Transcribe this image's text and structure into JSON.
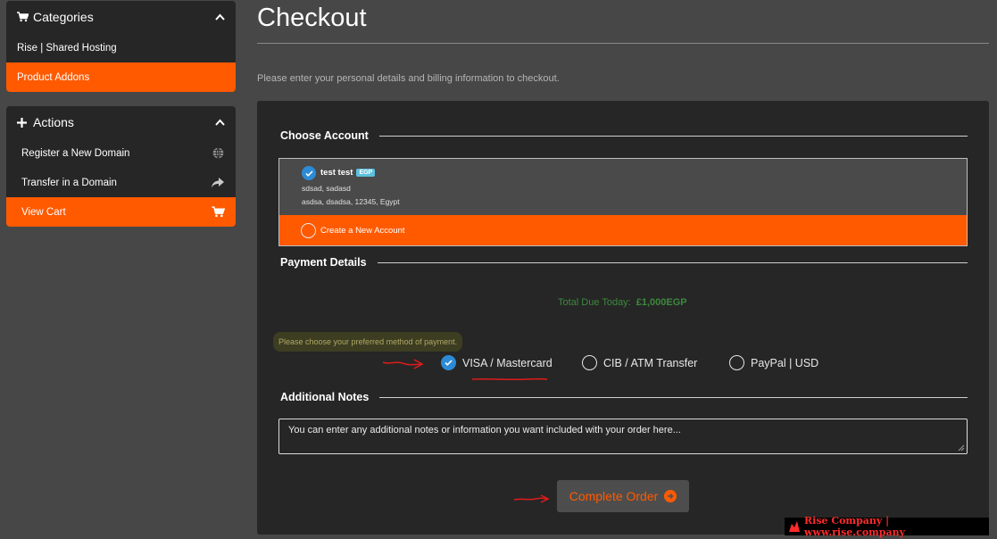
{
  "sidebar": {
    "categories": {
      "title": "Categories",
      "items": [
        {
          "label": "Rise | Shared Hosting",
          "active": false
        },
        {
          "label": "Product Addons",
          "active": true
        }
      ]
    },
    "actions": {
      "title": "Actions",
      "items": [
        {
          "label": "Register a New Domain",
          "icon": "globe-icon"
        },
        {
          "label": "Transfer in a Domain",
          "icon": "share-arrow-icon"
        },
        {
          "label": "View Cart",
          "icon": "cart-icon",
          "active": true
        }
      ]
    }
  },
  "page": {
    "title": "Checkout",
    "intro": "Please enter your personal details and billing information to checkout."
  },
  "account": {
    "section_title": "Choose Account",
    "selected": {
      "name": "test test",
      "currency_badge": "EGP",
      "line1": "sdsad, sadasd",
      "line2": "asdsa, dsadsa, 12345, Egypt"
    },
    "new_account_label": "Create a New Account"
  },
  "payment": {
    "section_title": "Payment Details",
    "total_label": "Total Due Today:",
    "total_value": "£1,000EGP",
    "hint": "Please choose your preferred method of payment.",
    "options": [
      {
        "label": "VISA / Mastercard",
        "selected": true
      },
      {
        "label": "CIB / ATM Transfer",
        "selected": false
      },
      {
        "label": "PayPal | USD",
        "selected": false
      }
    ]
  },
  "notes": {
    "section_title": "Additional Notes",
    "placeholder": "You can enter any additional notes or information you want included with your order here..."
  },
  "order": {
    "button_label": "Complete Order"
  },
  "watermark": {
    "text": "Rise Company | www.rise.company"
  },
  "colors": {
    "accent": "#ff5a00",
    "panel": "#262626",
    "background": "#474747",
    "check": "#2d8bd6",
    "annotation": "#e01b1b"
  }
}
